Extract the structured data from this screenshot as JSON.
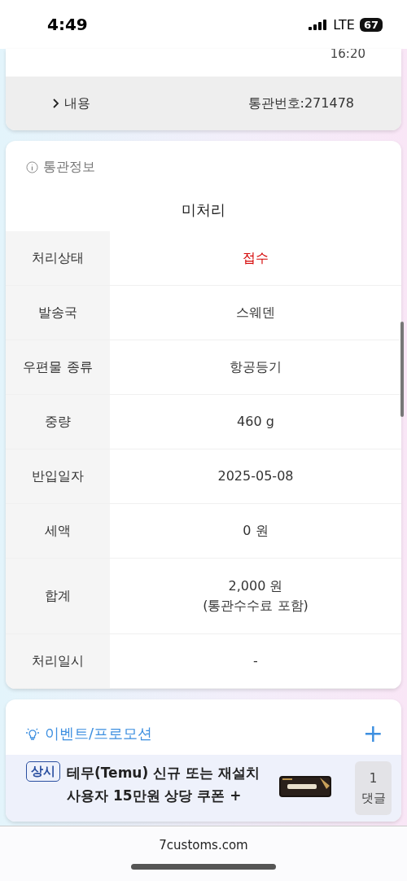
{
  "status_bar": {
    "time": "4:49",
    "network": "LTE",
    "battery": "67"
  },
  "top_card": {
    "time": "16:20",
    "toggle": "내용",
    "customs_no": "통관번호:271478"
  },
  "customs_info": {
    "title": "통관정보",
    "status_heading": "미처리",
    "rows": [
      {
        "label": "처리상태",
        "value": "접수",
        "kind": "alert"
      },
      {
        "label": "발송국",
        "value": "스웨덴",
        "kind": "plain"
      },
      {
        "label": "우편물 종류",
        "value": "항공등기",
        "kind": "plain"
      },
      {
        "label": "중량",
        "value": "460 g",
        "kind": "plain"
      },
      {
        "label": "반입일자",
        "value": "2025-05-08",
        "kind": "plain"
      },
      {
        "label": "세액",
        "value": "0 원",
        "kind": "plain"
      },
      {
        "label": "합계",
        "value": "2,000 원",
        "note": "(통관수수료 포함)",
        "kind": "plain"
      },
      {
        "label": "처리일시",
        "value": "-",
        "kind": "plain"
      }
    ]
  },
  "events": {
    "title": "이벤트/프로모션",
    "add": "+",
    "items": [
      {
        "tag": "상시",
        "title": "테무(Temu) 신규 또는 재설치 사용자 15만원 상당 쿠폰 +",
        "comment_count": "1",
        "comment_label": "댓글"
      }
    ]
  },
  "browser_bar": {
    "url": "7customs.com"
  }
}
